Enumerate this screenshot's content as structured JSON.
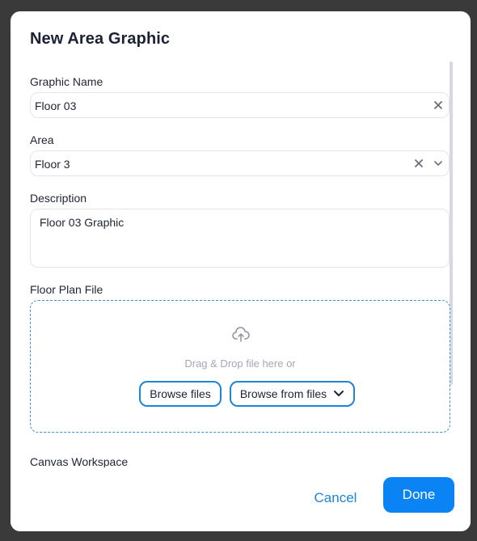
{
  "dialog": {
    "title": "New Area Graphic"
  },
  "graphic_name": {
    "label": "Graphic Name",
    "value": "Floor 03"
  },
  "area": {
    "label": "Area",
    "value": "Floor 3"
  },
  "description": {
    "label": "Description",
    "value": "Floor 03 Graphic"
  },
  "floor_plan": {
    "label": "Floor Plan File",
    "drop_text": "Drag & Drop file here or",
    "browse_files": "Browse files",
    "browse_from_files": "Browse from files"
  },
  "canvas": {
    "label": "Canvas Workspace"
  },
  "footer": {
    "cancel": "Cancel",
    "done": "Done"
  },
  "icons": {
    "clear": "close-icon",
    "dropdown": "chevron-down-icon",
    "upload": "cloud-upload-icon"
  },
  "colors": {
    "accent": "#0a84f5",
    "link": "#1e84d6",
    "dashed_border": "#3a8fd6"
  }
}
